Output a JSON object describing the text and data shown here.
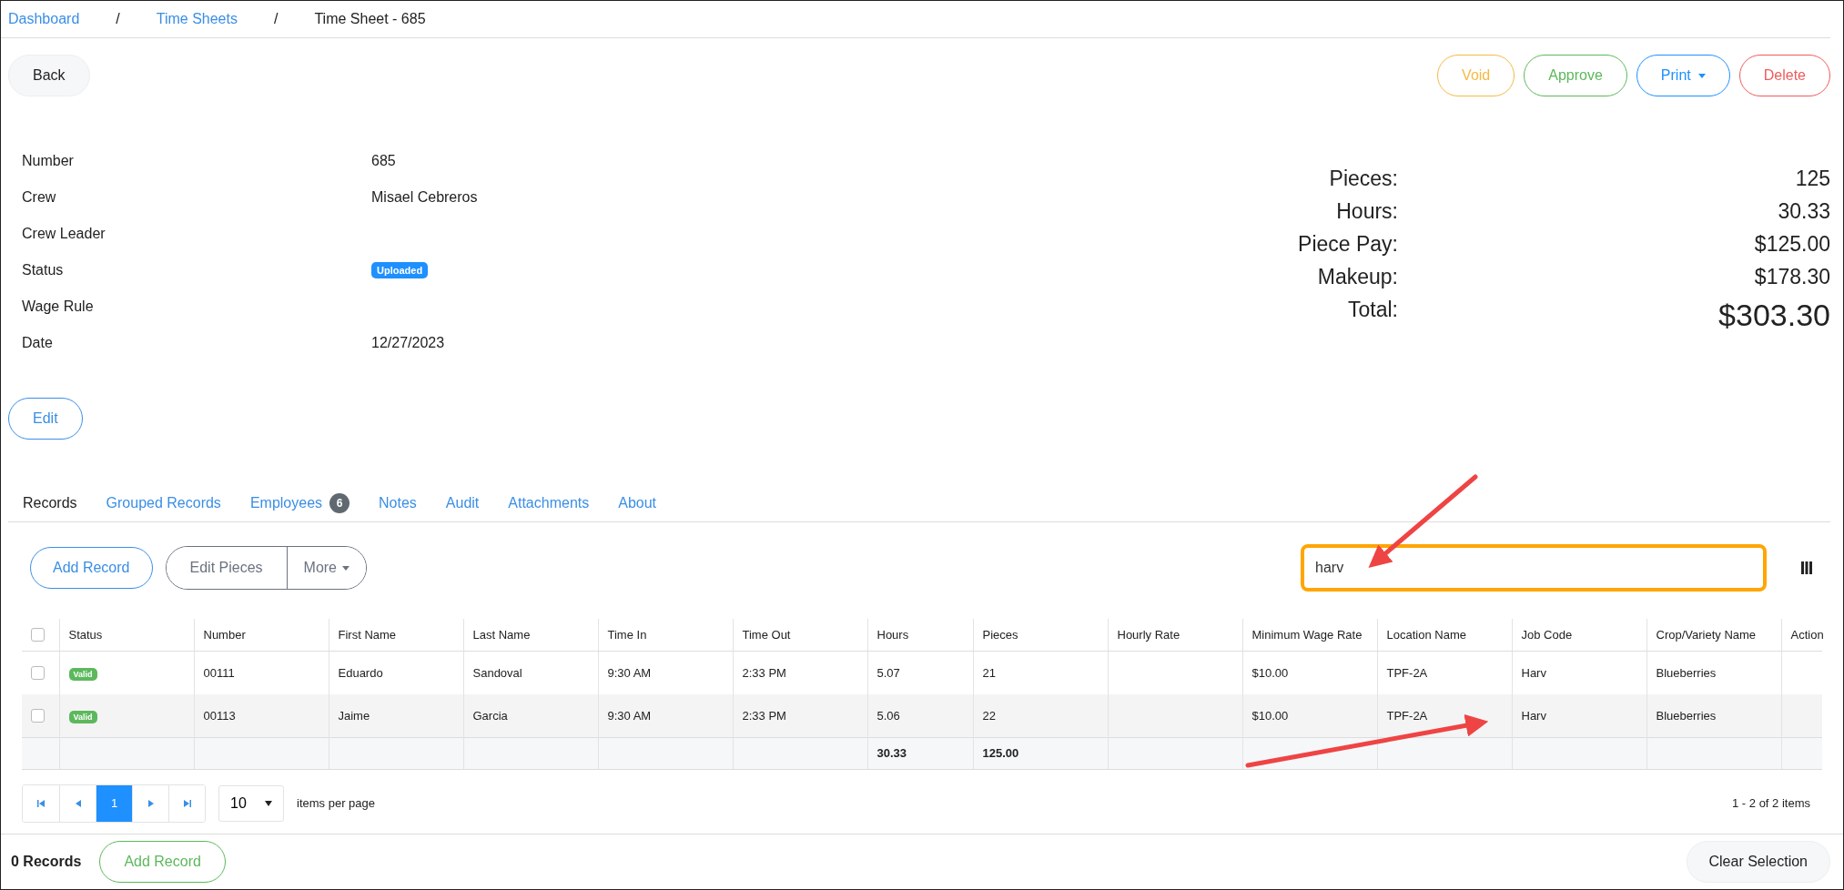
{
  "breadcrumb": [
    {
      "label": "Dashboard",
      "kind": "link"
    },
    {
      "label": "Time Sheets",
      "kind": "link"
    },
    {
      "label": "Time Sheet - 685",
      "kind": "current"
    }
  ],
  "separator": "/",
  "back_button": "Back",
  "actions": [
    {
      "label": "Void",
      "color": "#f5b942",
      "caret": false
    },
    {
      "label": "Approve",
      "color": "#5cb85c",
      "caret": false
    },
    {
      "label": "Print",
      "color": "#1e90ff",
      "caret": true
    },
    {
      "label": "Delete",
      "color": "#ef5b5b",
      "caret": false
    }
  ],
  "details": [
    {
      "label": "Number",
      "value": "685",
      "kind": "text"
    },
    {
      "label": "Crew",
      "value": "Misael Cebreros",
      "kind": "text"
    },
    {
      "label": "Crew Leader",
      "kind": "text"
    },
    {
      "label": "Status",
      "value": "Uploaded",
      "kind": "badge"
    },
    {
      "label": "Wage Rule",
      "kind": "text"
    },
    {
      "label": "Date",
      "value": "12/27/2023",
      "kind": "text"
    }
  ],
  "summary": [
    {
      "label": "Pieces:",
      "value": "125",
      "kind": "normal"
    },
    {
      "label": "Hours:",
      "value": "30.33",
      "kind": "normal"
    },
    {
      "label": "Piece Pay:",
      "value": "$125.00",
      "kind": "normal"
    },
    {
      "label": "Makeup:",
      "value": "$178.30",
      "kind": "normal"
    },
    {
      "label": "Total:",
      "value": "$303.30",
      "kind": "total"
    }
  ],
  "edit_button": "Edit",
  "tabs": [
    {
      "label": "Records",
      "selected": true
    },
    {
      "label": "Grouped Records",
      "selected": false
    },
    {
      "label": "Employees",
      "selected": false,
      "count": "6"
    },
    {
      "label": "Notes",
      "selected": false
    },
    {
      "label": "Audit",
      "selected": false
    },
    {
      "label": "Attachments",
      "selected": false
    },
    {
      "label": "About",
      "selected": false
    }
  ],
  "toolbar": {
    "add_button": "Add Record",
    "group": [
      "Edit Pieces",
      "More"
    ]
  },
  "search": {
    "value": "harv"
  },
  "table": {
    "columns": [
      "Status",
      "Number",
      "First Name",
      "Last Name",
      "Time In",
      "Time Out",
      "Hours",
      "Pieces",
      "Hourly Rate",
      "Minimum Wage Rate",
      "Location Name",
      "Job Code",
      "Crop/Variety Name",
      "Action"
    ],
    "header_checked": false,
    "rows": [
      {
        "checked": false,
        "cells": [
          "Valid",
          "00111",
          "Eduardo",
          "Sandoval",
          "9:30 AM",
          "2:33 PM",
          "5.07",
          "21",
          "",
          "$10.00",
          "TPF-2A",
          "Harv",
          "Blueberries",
          ""
        ]
      },
      {
        "checked": false,
        "cells": [
          "Valid",
          "00113",
          "Jaime",
          "Garcia",
          "9:30 AM",
          "2:33 PM",
          "5.06",
          "22",
          "",
          "$10.00",
          "TPF-2A",
          "Harv",
          "Blueberries",
          ""
        ]
      }
    ],
    "totals": {
      "hours": "30.33",
      "pieces": "125.00"
    }
  },
  "pager": {
    "pages": [
      {
        "label": "1",
        "selected": true
      }
    ],
    "page_size": "10",
    "per_page_label": "items per page",
    "range": "1 - 2 of 2 items"
  },
  "footer": {
    "count": "0 Records",
    "add_button": "Add Record",
    "clear_button": "Clear Selection"
  }
}
